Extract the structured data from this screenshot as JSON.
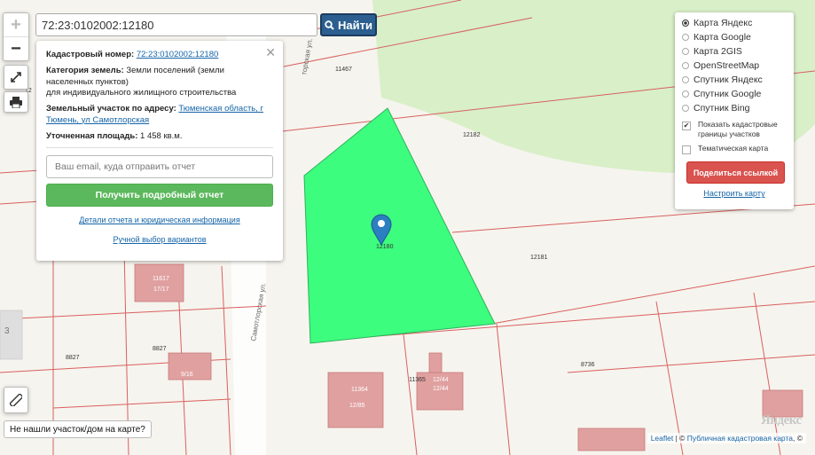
{
  "search": {
    "value": "72:23:0102002:12180",
    "button_label": "Найти"
  },
  "info_panel": {
    "close_symbol": "✕",
    "cadastral_label": "Кадастровый номер:",
    "cadastral_value": "72:23:0102002:12180",
    "land_category_label": "Категория земель:",
    "land_category_value": "Земли поселений (земли населенных пунктов)",
    "land_use": "для индивидуального жилищного строительства",
    "address_label": "Земельный участок по адресу:",
    "address_value": "Тюменская область, г Тюмень, ул Самотлорская",
    "area_label": "Уточненная площадь:",
    "area_value": "1 458 кв.м.",
    "email_placeholder": "Ваш email, куда отправить отчет",
    "report_button": "Получить подробный отчет",
    "details_link": "Детали отчета и юридическая информация",
    "manual_link": "Ручной выбор вариантов"
  },
  "layers": {
    "options": [
      {
        "label": "Карта Яндекс",
        "selected": true
      },
      {
        "label": "Карта Google",
        "selected": false
      },
      {
        "label": "Карта 2GIS",
        "selected": false
      },
      {
        "label": "OpenStreetMap",
        "selected": false
      },
      {
        "label": "Спутник Яндекс",
        "selected": false
      },
      {
        "label": "Спутник Google",
        "selected": false
      },
      {
        "label": "Спутник Bing",
        "selected": false
      }
    ],
    "show_cadastral": {
      "label": "Показать кадастровые границы участков",
      "checked": true
    },
    "thematic": {
      "label": "Тематическая карта",
      "checked": false
    },
    "share_button": "Поделиться ссылкой",
    "config_link": "Настроить карту"
  },
  "controls": {
    "zoom_in": "+",
    "zoom_out": "−"
  },
  "not_found_button": "Не нашли участок/дом на карте?",
  "attribution": {
    "leaflet": "Leaflet",
    "sep": " | © ",
    "cadastral": "Публичная кадастровая карта",
    "tail": ", ©"
  },
  "logo": "Яндекс",
  "map": {
    "parcel_labels": [
      "11467",
      "12182",
      "12181",
      "8736",
      "8827",
      "11365",
      "12180",
      "12",
      "3"
    ],
    "building_labels": [
      "11617",
      "17/17",
      "8827",
      "9/16",
      "11364",
      "12/85",
      "12/44",
      "12/44"
    ],
    "street_labels": [
      "Самотлорская ул.",
      "торская ул."
    ]
  },
  "colors": {
    "highlight": "#3dfd7e",
    "park": "#d8efc8",
    "building": "#e0a0a0",
    "boundary": "#d96060",
    "accent": "#2c5f8f"
  }
}
